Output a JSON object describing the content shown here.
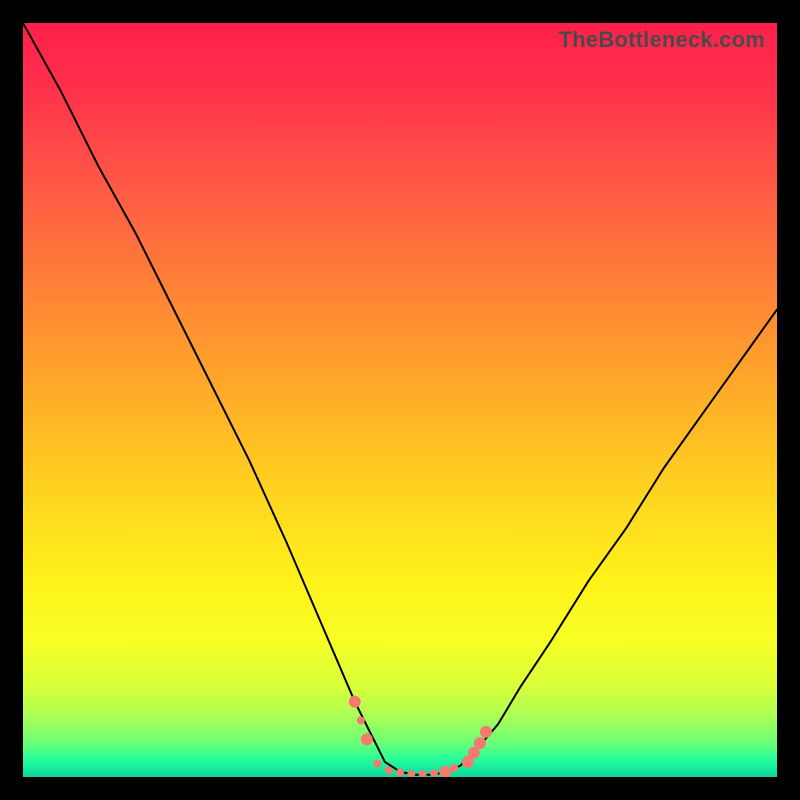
{
  "watermark": "TheBottleneck.com",
  "chart_data": {
    "type": "line",
    "title": "",
    "xlabel": "",
    "ylabel": "",
    "xlim": [
      0,
      100
    ],
    "ylim": [
      0,
      100
    ],
    "grid": false,
    "legend": false,
    "notes": "Bottleneck curve: sharp descent from top-left, flat minimum around x≈48–58 near y≈0, then rises toward upper-right (reaching ~y≈62 at x=100). Small salmon markers cluster near the curve's minimum.",
    "series": [
      {
        "name": "bottleneck-curve",
        "color": "#000000",
        "x": [
          0,
          5,
          10,
          15,
          20,
          25,
          30,
          35,
          38,
          41,
          44,
          46,
          48,
          50,
          52,
          54,
          56,
          58,
          60,
          63,
          66,
          70,
          75,
          80,
          85,
          90,
          95,
          100
        ],
        "y": [
          100,
          91,
          81,
          72,
          62,
          52,
          42,
          31,
          24,
          17,
          10,
          6,
          2,
          0.7,
          0.3,
          0.3,
          0.6,
          1.5,
          3.5,
          7,
          12,
          18,
          26,
          33,
          41,
          48,
          55,
          62
        ]
      }
    ],
    "markers": {
      "name": "sample-points",
      "color": "#f47a70",
      "radius_small": 4,
      "radius_large": 6,
      "points": [
        {
          "x": 44.0,
          "y": 10.0,
          "r": "large"
        },
        {
          "x": 44.8,
          "y": 7.5,
          "r": "small"
        },
        {
          "x": 45.6,
          "y": 5.0,
          "r": "large"
        },
        {
          "x": 47.0,
          "y": 1.8,
          "r": "small"
        },
        {
          "x": 48.5,
          "y": 0.9,
          "r": "small"
        },
        {
          "x": 50.0,
          "y": 0.6,
          "r": "small"
        },
        {
          "x": 51.5,
          "y": 0.4,
          "r": "small"
        },
        {
          "x": 53.0,
          "y": 0.4,
          "r": "small"
        },
        {
          "x": 54.5,
          "y": 0.5,
          "r": "small"
        },
        {
          "x": 56.0,
          "y": 0.7,
          "r": "large"
        },
        {
          "x": 57.2,
          "y": 1.2,
          "r": "small"
        },
        {
          "x": 59.0,
          "y": 2.0,
          "r": "large"
        },
        {
          "x": 59.8,
          "y": 3.2,
          "r": "large"
        },
        {
          "x": 60.6,
          "y": 4.5,
          "r": "large"
        },
        {
          "x": 61.4,
          "y": 6.0,
          "r": "large"
        }
      ]
    }
  }
}
